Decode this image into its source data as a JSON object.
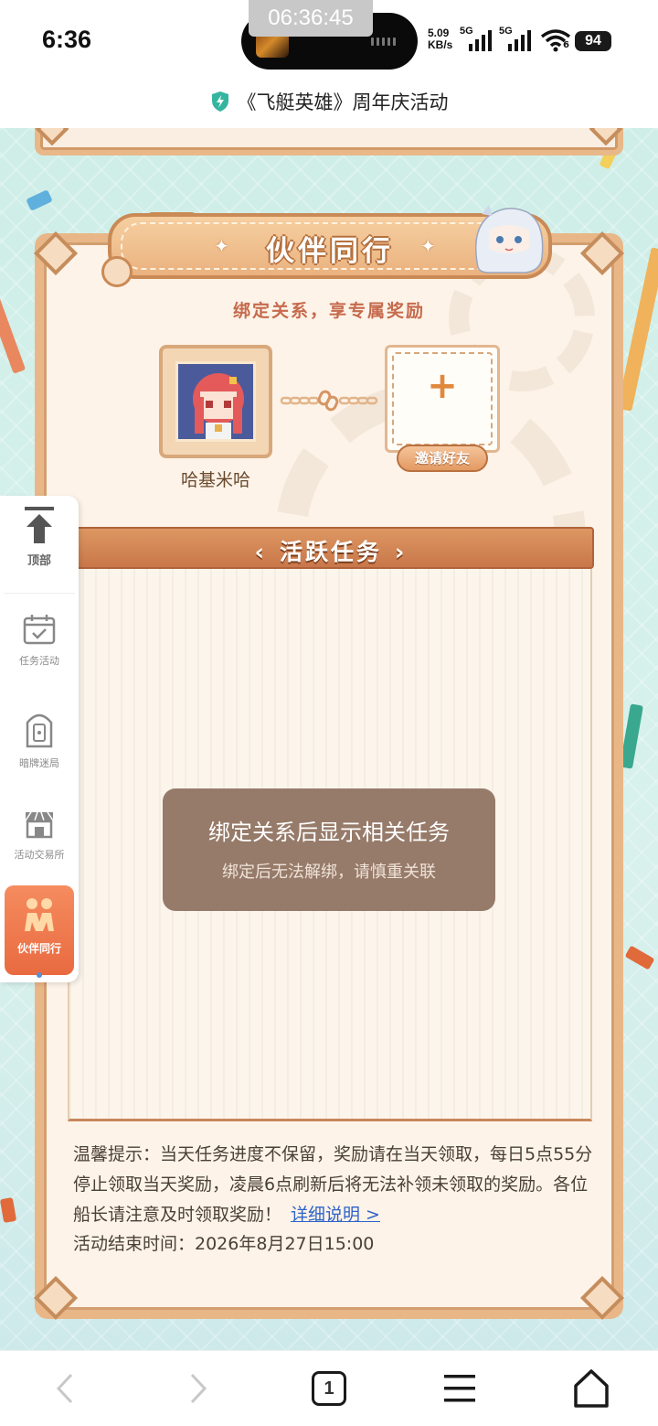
{
  "status_bar": {
    "time": "6:36",
    "capsule_time": "06:36:45",
    "net_speed_value": "5.09",
    "net_speed_unit": "KB/s",
    "signal_label_1": "5G",
    "signal_label_2": "5G",
    "wifi_label": "6",
    "battery": "94"
  },
  "address_bar": {
    "title": "《飞艇英雄》周年庆活动",
    "shield_icon": "shield-lightning-icon"
  },
  "header": {
    "title": "伙伴同行"
  },
  "bind": {
    "subtitle": "绑定关系，享专属奖励",
    "partner_name": "哈基米哈",
    "invite_label": "邀请好友",
    "plus_label": "+"
  },
  "tasks": {
    "title": "活跃任务",
    "prev_label": "‹",
    "next_label": "›",
    "toast_title": "绑定关系后显示相关任务",
    "toast_subtitle": "绑定后无法解绑，请慎重关联"
  },
  "tips": {
    "text": "温馨提示：当天任务进度不保留，奖励请在当天领取，每日5点55分停止领取当天奖励，凌晨6点刷新后将无法补领未领取的奖励。各位船长请注意及时领取奖励！",
    "link": "详细说明 >",
    "end_time": "活动结束时间：2026年8月27日15:00"
  },
  "side_nav": {
    "items": [
      {
        "label": "顶部",
        "icon": "arrow-up-icon"
      },
      {
        "label": "任务活动",
        "icon": "calendar-check-icon"
      },
      {
        "label": "暗牌迷局",
        "icon": "card-door-icon"
      },
      {
        "label": "活动交易所",
        "icon": "shop-icon"
      },
      {
        "label": "伙伴同行",
        "icon": "partners-icon"
      }
    ],
    "active_index": 4
  },
  "bottom_bar": {
    "tab_count": "1"
  },
  "colors": {
    "accent_orange": "#e96a40",
    "frame_brown": "#c98a55",
    "page_bg": "#d8f1ec",
    "link_blue": "#2e63c9"
  }
}
